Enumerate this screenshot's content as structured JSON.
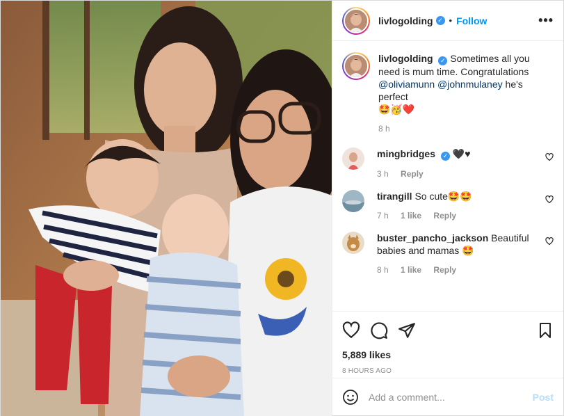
{
  "header": {
    "username": "livlogolding",
    "follow_label": "Follow",
    "separator": "•",
    "more_label": "•••"
  },
  "caption": {
    "username": "livlogolding",
    "text": "Sometimes all you need is mum time. Congratulations",
    "mention_1": "@oliviamunn",
    "mention_2": "@johnmulaney",
    "text_end": "he's perfect",
    "emojis": "🤩🥳❤️",
    "time": "8 h"
  },
  "comments": [
    {
      "username": "mingbridges",
      "verified": true,
      "text": "🖤♥",
      "time": "3 h",
      "likes": "",
      "reply": "Reply"
    },
    {
      "username": "tirangill",
      "verified": false,
      "text": "So cute🤩🤩",
      "time": "7 h",
      "likes": "1 like",
      "reply": "Reply"
    },
    {
      "username": "buster_pancho_jackson",
      "verified": false,
      "text": "Beautiful babies and mamas 🤩",
      "time": "8 h",
      "likes": "1 like",
      "reply": "Reply"
    }
  ],
  "actions": {
    "likes": "5,889 likes",
    "posted": "8 HOURS AGO"
  },
  "add_comment": {
    "placeholder": "Add a comment...",
    "post_label": "Post"
  },
  "colors": {
    "accent": "#0095f6",
    "verified": "#3897f0",
    "muted": "#8e8e8e"
  }
}
